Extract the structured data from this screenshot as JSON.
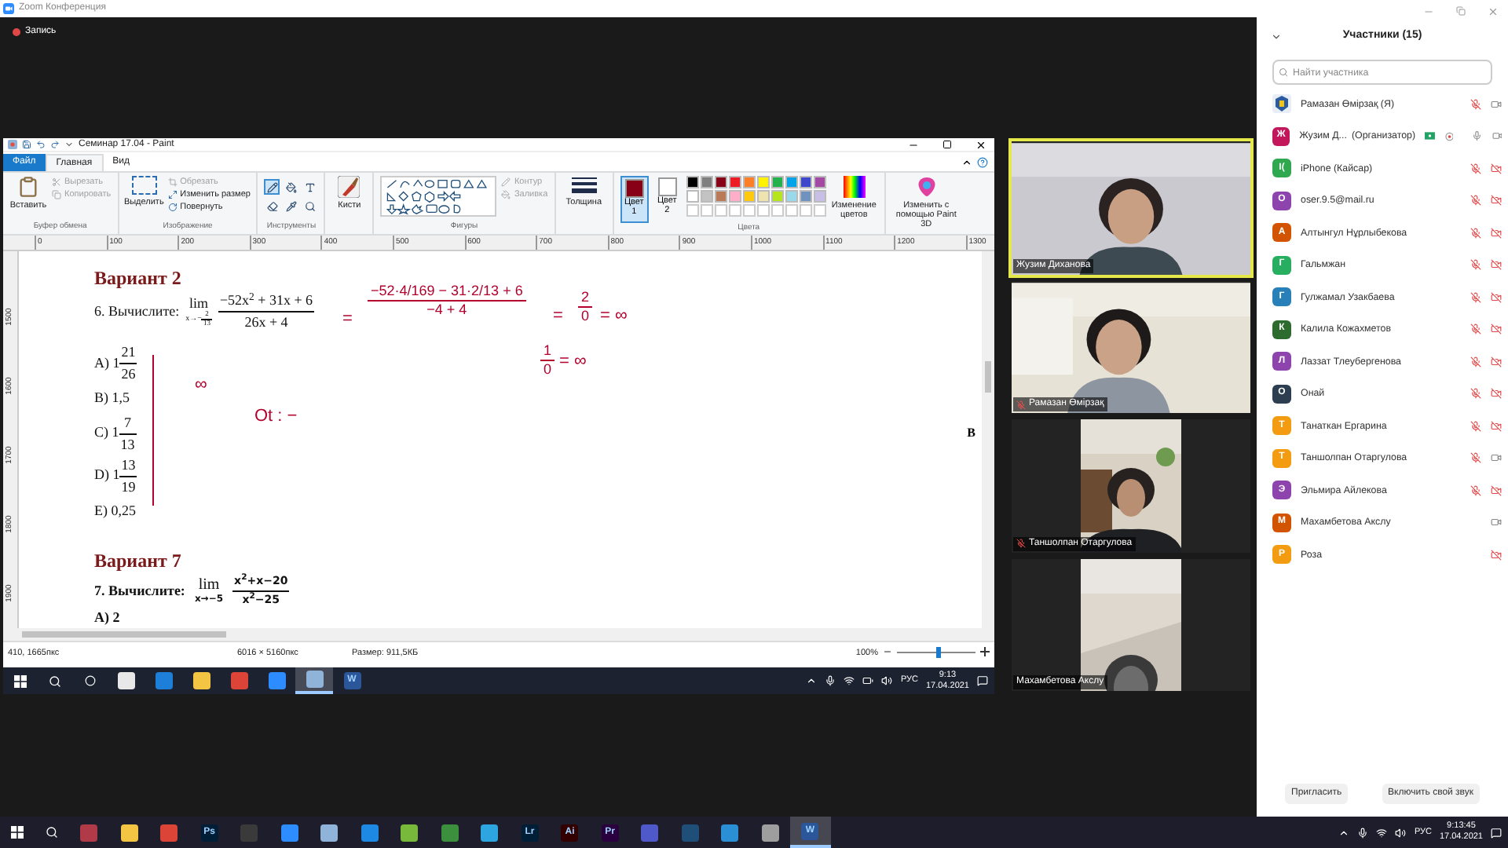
{
  "window": {
    "title": "Zoom Конференция"
  },
  "recording": {
    "label": "Запись"
  },
  "paint": {
    "title": "Семинар 17.04 - Paint",
    "tabs": [
      {
        "label": "Файл",
        "selected": false,
        "kind": "file"
      },
      {
        "label": "Главная",
        "selected": true,
        "kind": "tab"
      },
      {
        "label": "Вид",
        "selected": false,
        "kind": "tab"
      }
    ],
    "clipboard": {
      "label": "Буфер обмена",
      "big": "Вставить",
      "items": [
        {
          "label": "Вырезать",
          "disabled": true
        },
        {
          "label": "Копировать",
          "disabled": true
        }
      ]
    },
    "image": {
      "label": "Изображение",
      "big": "Выделить",
      "items": [
        {
          "label": "Обрезать",
          "disabled": true
        },
        {
          "label": "Изменить размер",
          "disabled": false
        },
        {
          "label": "Повернуть",
          "disabled": false
        }
      ]
    },
    "tools": {
      "label": "Инструменты",
      "items": [
        {
          "kind": "pencil",
          "selected": true
        },
        {
          "kind": "fill",
          "selected": false
        },
        {
          "kind": "text",
          "selected": false
        },
        {
          "kind": "eraser",
          "selected": false
        },
        {
          "kind": "picker",
          "selected": false
        },
        {
          "kind": "zoom",
          "selected": false
        }
      ]
    },
    "brushes": {
      "big": "Кисти"
    },
    "shapes": {
      "label": "Фигуры",
      "items": [
        {
          "label": "Контур",
          "disabled": true
        },
        {
          "label": "Заливка",
          "disabled": true
        }
      ]
    },
    "size": {
      "big": "Толщина"
    },
    "colors": {
      "label": "Цвета",
      "slots": [
        {
          "label": "Цвет 1",
          "color": "#880015",
          "selected": true
        },
        {
          "label": "Цвет 2",
          "color": "#ffffff",
          "selected": false
        }
      ],
      "palette": [
        {
          "color": "#000000"
        },
        {
          "color": "#7f7f7f"
        },
        {
          "color": "#880015"
        },
        {
          "color": "#ed1c24"
        },
        {
          "color": "#ff7f27"
        },
        {
          "color": "#fff200"
        },
        {
          "color": "#22b14c"
        },
        {
          "color": "#00a2e8"
        },
        {
          "color": "#3f48cc"
        },
        {
          "color": "#a349a4"
        },
        {
          "color": "#ffffff"
        },
        {
          "color": "#c3c3c3"
        },
        {
          "color": "#b97a57"
        },
        {
          "color": "#ffaec9"
        },
        {
          "color": "#ffc90e"
        },
        {
          "color": "#efe4b0"
        },
        {
          "color": "#b5e61d"
        },
        {
          "color": "#99d9ea"
        },
        {
          "color": "#7092be"
        },
        {
          "color": "#c8bfe7"
        }
      ],
      "edit": "Изменение цветов"
    },
    "paint3d": {
      "big": "Изменить с помощью Paint 3D"
    },
    "ruler": [
      "0",
      "100",
      "200",
      "300",
      "400",
      "500",
      "600",
      "700",
      "800",
      "900",
      "1000",
      "1100",
      "1200",
      "1300"
    ],
    "vruler": [
      "1500",
      "1600",
      "1700",
      "1800",
      "1900"
    ],
    "document": {
      "heading_1": "Вариант 2",
      "task_1": {
        "label": "6. Вычислите:",
        "lim": "lim",
        "approach": "x→−",
        "approach_num": "2",
        "approach_den": "13",
        "numerator": "−52x$^{2}$ + 31x + 6",
        "denominator": "26x + 4"
      },
      "answers": [
        {
          "kind": "fraction",
          "letter": "A) 1",
          "num": "21",
          "den": "26"
        },
        {
          "kind": "plain",
          "letter": "B) 1,5"
        },
        {
          "kind": "fraction",
          "letter": "C) 1",
          "num": "7",
          "den": "13"
        },
        {
          "kind": "fraction",
          "letter": "D) 1",
          "num": "13",
          "den": "19"
        },
        {
          "kind": "plain",
          "letter": "E) 0,25"
        }
      ],
      "heading_2": "Вариант 7",
      "task_2": {
        "label": "7. Вычислите:",
        "lim": "lim",
        "approach": "x→−5",
        "numerator": "x$^{2}$+x−20",
        "denominator": "x$^{2}$−25"
      },
      "answer_2": "A) 2",
      "edge_letter": "В"
    },
    "handwriting": [
      {
        "kind": "text",
        "text": "="
      },
      {
        "kind": "fraction",
        "num": "−52·4/169 − 31·2/13 + 6",
        "den": "−4 + 4"
      },
      {
        "kind": "text",
        "text": "="
      },
      {
        "kind": "fraction",
        "num": "2",
        "den": "0"
      },
      {
        "kind": "text",
        "text": "= ∞"
      },
      {
        "kind": "fraction",
        "num": "1",
        "den": "0"
      },
      {
        "kind": "text",
        "text": "= ∞"
      },
      {
        "kind": "text",
        "text": "∞"
      },
      {
        "kind": "text",
        "text": "Ot : −"
      }
    ],
    "status": {
      "position": "410, 1665пкс",
      "dimensions": "6016 × 5160пкс",
      "file_size": "Размер: 911,5КБ",
      "zoom": "100%",
      "level": 0.5
    },
    "taskbar": {
      "apps": [
        {
          "color": "#e8e8e8",
          "selected": false
        },
        {
          "color": "#1e7fd8",
          "selected": false
        },
        {
          "color": "#f4c542",
          "selected": false
        },
        {
          "color": "#db4437",
          "selected": false
        },
        {
          "color": "#2d8cff",
          "selected": false
        },
        {
          "color": "#8fb3d9",
          "selected": true
        },
        {
          "color": "#2b579a",
          "label": "W",
          "selected": false
        }
      ],
      "language": "РУС",
      "time": "9:13",
      "date": "17.04.2021"
    }
  },
  "videos": [
    {
      "name": "Жузим Диханова",
      "active": true,
      "muted": false
    },
    {
      "name": "Рамазан Өмірзақ",
      "active": false,
      "muted": true
    },
    {
      "name": "Таншолпан Отаргулова",
      "active": false,
      "muted": true
    },
    {
      "name": "Махамбетова Акслу",
      "active": false,
      "muted": false
    }
  ],
  "participants_panel": {
    "title": "Участники (15)",
    "search": {
      "placeholder": "Найти участника"
    },
    "participants": [
      {
        "name": "Рамазан Өмірзақ (Я)",
        "mic_shown": true,
        "muted": true,
        "camera_off": false
      },
      {
        "name": "Жузим Д...",
        "role": "(Организатор)",
        "initial": "Ж",
        "color": "#c2185b",
        "kind": "host",
        "mic_shown": true,
        "muted": false,
        "camera_off": false
      },
      {
        "name": "iPhone (Кайсар)",
        "initial": "I(",
        "color": "#2fa84f",
        "kind": "letter",
        "mic_shown": true,
        "muted": true,
        "camera_off": true
      },
      {
        "name": "oser.9.5@mail.ru",
        "initial": "O",
        "color": "#8e44ad",
        "kind": "letter",
        "mic_shown": true,
        "muted": true,
        "camera_off": true
      },
      {
        "name": "Алтынгул Нұрлыбекова",
        "initial": "А",
        "color": "#d35400",
        "kind": "letter",
        "mic_shown": true,
        "muted": true,
        "camera_off": true
      },
      {
        "name": "Гальмжан",
        "initial": "Г",
        "color": "#27ae60",
        "kind": "letter",
        "mic_shown": true,
        "muted": true,
        "camera_off": true
      },
      {
        "name": "Гулжамал Узакбаева",
        "initial": "Г",
        "color": "#2980b9",
        "kind": "letter",
        "mic_shown": true,
        "muted": true,
        "camera_off": true
      },
      {
        "name": "Калила Кожахметов",
        "initial": "К",
        "color": "#2e6b2e",
        "kind": "letter",
        "mic_shown": true,
        "muted": true,
        "camera_off": true
      },
      {
        "name": "Лаззат Тлеубергенова",
        "initial": "Л",
        "color": "#8e44ad",
        "kind": "letter",
        "mic_shown": true,
        "muted": true,
        "camera_off": true
      },
      {
        "name": "Онай",
        "initial": "О",
        "color": "#2c3e50",
        "kind": "letter",
        "mic_shown": true,
        "muted": true,
        "camera_off": true
      },
      {
        "name": "Танаткан Ергарина",
        "initial": "Т",
        "color": "#f39c12",
        "kind": "letter",
        "mic_shown": true,
        "muted": true,
        "camera_off": true
      },
      {
        "name": "Таншолпан Отаргулова",
        "initial": "Т",
        "color": "#f39c12",
        "kind": "letter",
        "mic_shown": true,
        "muted": true,
        "camera_off": false
      },
      {
        "name": "Эльмира Айлекова",
        "initial": "Э",
        "color": "#8e44ad",
        "kind": "letter",
        "mic_shown": true,
        "muted": true,
        "camera_off": true
      },
      {
        "name": "Махамбетова Акслу",
        "initial": "М",
        "color": "#d35400",
        "kind": "letter",
        "mic_shown": false,
        "camera_off": false
      },
      {
        "name": "Роза",
        "initial": "Р",
        "color": "#f39c12",
        "kind": "letter",
        "mic_shown": false,
        "camera_off": true
      }
    ],
    "buttons": [
      "Пригласить",
      "Включить свой звук"
    ]
  },
  "taskbar": {
    "apps": [
      {
        "color": "#b03a48",
        "selected": false
      },
      {
        "color": "#f4c542",
        "selected": false
      },
      {
        "color": "#db4437",
        "selected": false
      },
      {
        "color": "#001e36",
        "label": "Ps",
        "selected": false
      },
      {
        "color": "#3a3a3a",
        "selected": false
      },
      {
        "color": "#2d8cff",
        "selected": false
      },
      {
        "color": "#8fb3d9",
        "selected": false
      },
      {
        "color": "#1e88e5",
        "selected": false
      },
      {
        "color": "#78b83a",
        "selected": false
      },
      {
        "color": "#3c8f3c",
        "selected": false
      },
      {
        "color": "#2ca5e0",
        "selected": false
      },
      {
        "color": "#001e36",
        "label": "Lr",
        "selected": false
      },
      {
        "color": "#330000",
        "label": "Ai",
        "selected": false
      },
      {
        "color": "#2a003f",
        "label": "Pr",
        "selected": false
      },
      {
        "color": "#5059c9",
        "selected": false
      },
      {
        "color": "#1f4e79",
        "selected": false
      },
      {
        "color": "#2b8fd6",
        "selected": false
      },
      {
        "color": "#9e9e9e",
        "selected": false
      },
      {
        "color": "#2b579a",
        "label": "W",
        "selected": true
      }
    ],
    "language": "РУС",
    "time": "9:13:45",
    "date": "17.04.2021"
  }
}
